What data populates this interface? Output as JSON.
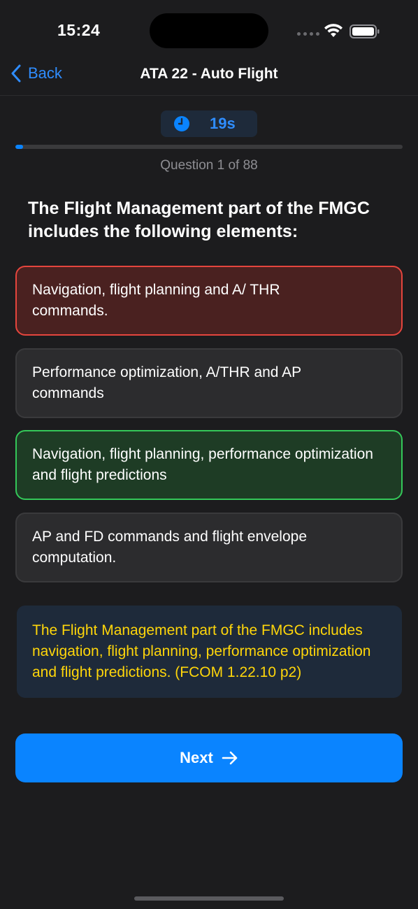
{
  "status": {
    "time": "15:24"
  },
  "nav": {
    "back_label": "Back",
    "title": "ATA 22 - Auto Flight"
  },
  "timer": {
    "value": "19s",
    "icon": "clock-icon"
  },
  "progress": {
    "fraction": 0.02,
    "label": "Question 1 of 88"
  },
  "question": {
    "text": "The Flight Management part of the FMGC includes the following elements:"
  },
  "answers": [
    {
      "text": "Navigation, flight planning and A/ THR commands.",
      "state": "wrong"
    },
    {
      "text": "Performance optimization, A/THR and AP commands",
      "state": "neutral"
    },
    {
      "text": "Navigation, flight planning, performance optimization and flight predictions",
      "state": "correct"
    },
    {
      "text": "AP and FD commands and flight envelope computation.",
      "state": "neutral"
    }
  ],
  "explanation": {
    "text": "The Flight Management part of the FMGC includes navigation, flight planning, performance optimization and flight predictions. (FCOM 1.22.10 p2)"
  },
  "next_button": {
    "label": "Next",
    "icon": "arrow-right-icon"
  },
  "colors": {
    "accent": "#0a84ff",
    "wrong": "#e5453d",
    "correct": "#34c759",
    "explanation_text": "#ffd60a"
  }
}
